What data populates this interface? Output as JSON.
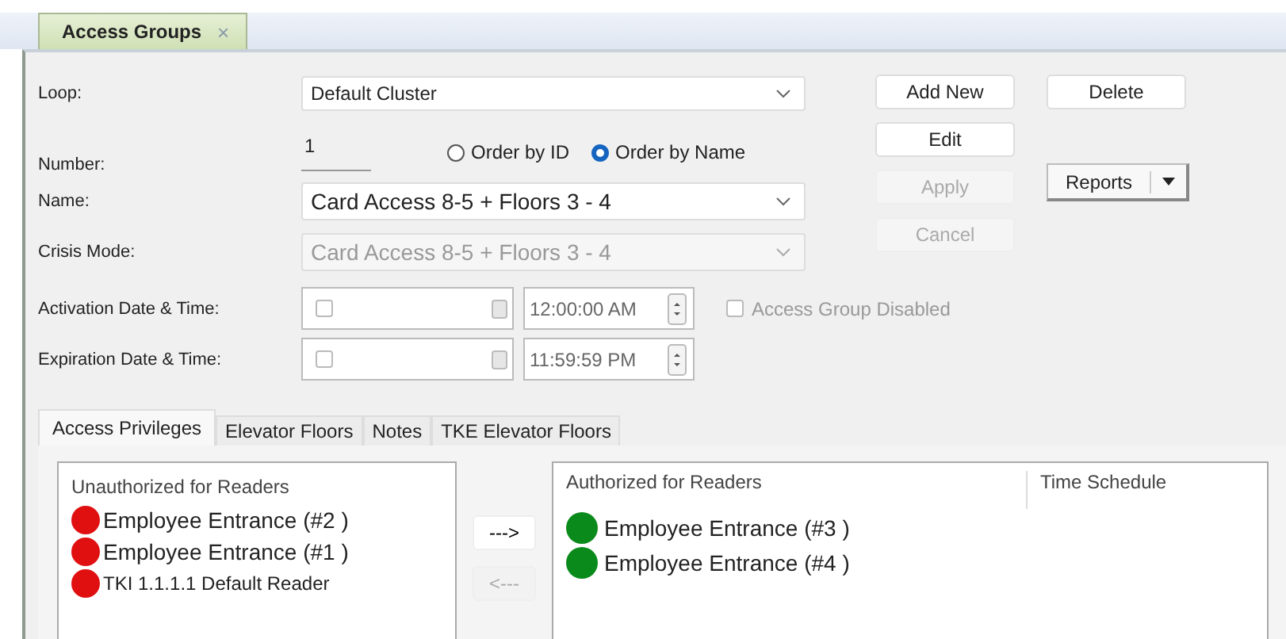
{
  "doc_tab": {
    "title": "Access Groups",
    "close": "×"
  },
  "form": {
    "loop": {
      "label": "Loop:",
      "value": "Default Cluster"
    },
    "number": {
      "label": "Number:",
      "value": "1"
    },
    "order_options": [
      {
        "label": "Order by ID",
        "selected": false
      },
      {
        "label": "Order by Name",
        "selected": true
      }
    ],
    "name": {
      "label": "Name:",
      "value": "Card Access 8-5 + Floors 3 - 4",
      "disabled": false
    },
    "crisis": {
      "label": "Crisis Mode:",
      "value": "Card Access 8-5 + Floors 3 - 4",
      "disabled": true
    },
    "dates": [
      {
        "label": "Activation Date & Time:",
        "checked": false,
        "time": "12:00:00 AM"
      },
      {
        "label": "Expiration Date & Time:",
        "checked": false,
        "time": "11:59:59 PM"
      }
    ],
    "disabled_check": {
      "label": "Access Group Disabled",
      "checked": false,
      "disabled": true
    }
  },
  "buttons": [
    {
      "label": "Add New",
      "disabled": false
    },
    {
      "label": "Edit",
      "disabled": false
    },
    {
      "label": "Apply",
      "disabled": true
    },
    {
      "label": "Cancel",
      "disabled": true
    }
  ],
  "delete_button": {
    "label": "Delete"
  },
  "reports_button": {
    "label": "Reports"
  },
  "tabs": [
    {
      "label": "Access Privileges",
      "selected": true
    },
    {
      "label": "Elevator Floors",
      "selected": false
    },
    {
      "label": "Notes",
      "selected": false
    },
    {
      "label": "TKE Elevator Floors",
      "selected": false
    }
  ],
  "unauthorized": {
    "heading": "Unauthorized for Readers",
    "items": [
      {
        "label": "Employee Entrance (#2 )",
        "color": "#e01010"
      },
      {
        "label": "Employee Entrance (#1 )",
        "color": "#e01010"
      },
      {
        "label": "TKI 1.1.1.1 Default Reader",
        "color": "#e01010"
      }
    ]
  },
  "move_buttons": [
    {
      "label": "--->",
      "disabled": false
    },
    {
      "label": "<---",
      "disabled": true
    }
  ],
  "authorized": {
    "columns": [
      "Authorized for Readers",
      "Time Schedule"
    ],
    "items": [
      {
        "label": "Employee Entrance (#3 )",
        "color": "#0a8a1a"
      },
      {
        "label": "Employee Entrance (#4 )",
        "color": "#0a8a1a"
      }
    ]
  }
}
